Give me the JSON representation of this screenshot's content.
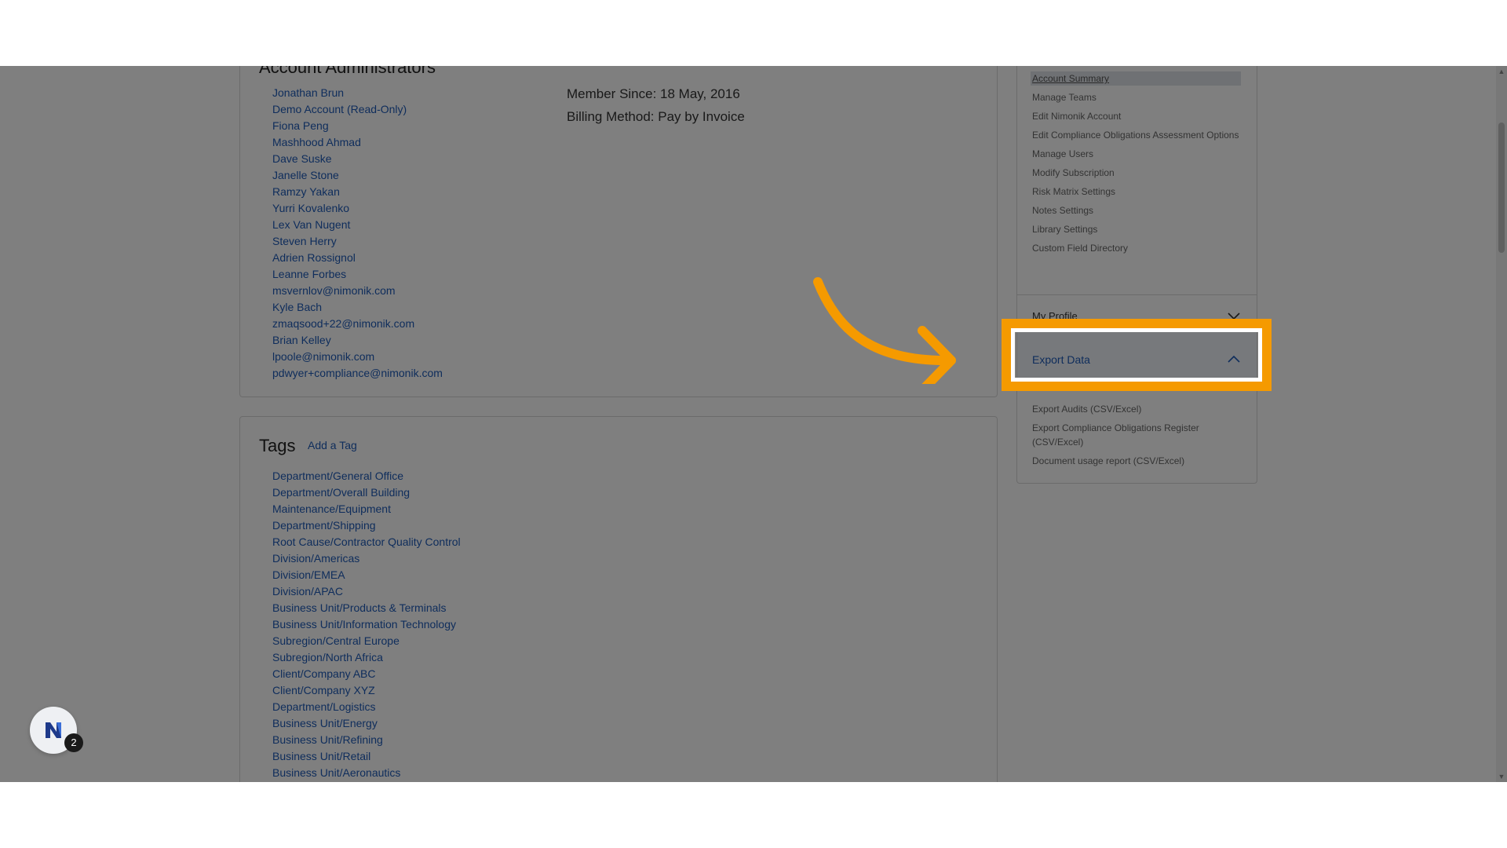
{
  "admins": {
    "title": "Account Administrators",
    "people": [
      "Jonathan Brun",
      "Demo Account (Read-Only)",
      "Fiona Peng",
      "Mashhood Ahmad",
      "Dave Suske",
      "Janelle Stone",
      "Ramzy Yakan",
      "Yurri Kovalenko",
      "Lex Van Nugent",
      "Steven Herry",
      "Adrien Rossignol",
      "Leanne Forbes",
      "msvernlov@nimonik.com",
      "Kyle Bach",
      "zmaqsood+22@nimonik.com",
      "Brian Kelley",
      "lpoole@nimonik.com",
      "pdwyer+compliance@nimonik.com"
    ],
    "member_since": "Member Since: 18 May, 2016",
    "billing_method": "Billing Method: Pay by Invoice"
  },
  "tags": {
    "title": "Tags",
    "add_label": "Add a Tag",
    "items": [
      "Department/General Office",
      "Department/Overall Building",
      "Maintenance/Equipment",
      "Department/Shipping",
      "Root Cause/Contractor Quality Control",
      "Division/Americas",
      "Division/EMEA",
      "Division/APAC",
      "Business Unit/Products & Terminals",
      "Business Unit/Information Technology",
      "Subregion/Central Europe",
      "Subregion/North Africa",
      "Client/Company ABC",
      "Client/Company XYZ",
      "Department/Logistics",
      "Business Unit/Energy",
      "Business Unit/Refining",
      "Business Unit/Retail",
      "Business Unit/Aeronautics"
    ]
  },
  "sidebar": {
    "account_menu": [
      "Account Summary",
      "Manage Teams",
      "Edit Nimonik Account",
      "Edit Compliance Obligations Assessment Options",
      "Manage Users",
      "Modify Subscription",
      "Risk Matrix Settings",
      "Notes Settings",
      "Library Settings",
      "Custom Field Directory"
    ],
    "my_profile_label": "My Profile",
    "export_data_label": "Export Data",
    "export_menu": [
      "Export Audits (CSV/Excel)",
      "Export Compliance Obligations Register (CSV/Excel)",
      "Document usage report (CSV/Excel)"
    ]
  },
  "widget": {
    "badge_count": "2",
    "logo_icon": "nimonik-logo-icon"
  },
  "colors": {
    "highlight": "#f59a00",
    "link": "#1e5bb8"
  }
}
